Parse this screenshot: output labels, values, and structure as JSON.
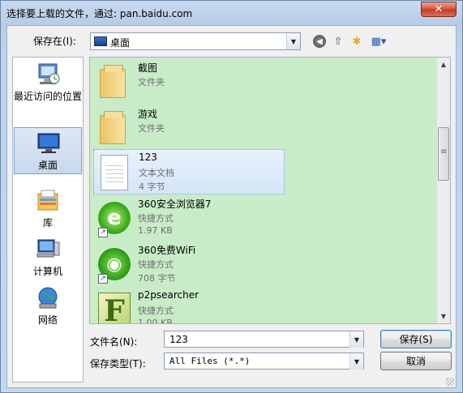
{
  "window": {
    "title": "选择要上载的文件，通过: pan.baidu.com",
    "close_glyph": "✕"
  },
  "toolbar": {
    "save_in_label": "保存在(I):",
    "save_in_value": "桌面",
    "icons": [
      "back-icon",
      "up-folder-icon",
      "new-folder-icon",
      "views-menu-icon"
    ]
  },
  "places": [
    {
      "label": "最近访问的位置",
      "icon": "recent-places-icon"
    },
    {
      "label": "桌面",
      "icon": "desktop-icon",
      "selected": true
    },
    {
      "label": "库",
      "icon": "libraries-icon"
    },
    {
      "label": "计算机",
      "icon": "computer-icon"
    },
    {
      "label": "网络",
      "icon": "network-icon"
    }
  ],
  "files": [
    {
      "name": "截图",
      "type": "文件夹",
      "size": "",
      "icon": "folder-icon"
    },
    {
      "name": "游戏",
      "type": "文件夹",
      "size": "",
      "icon": "folder-icon"
    },
    {
      "name": "123",
      "type": "文本文档",
      "size": "4 字节",
      "icon": "text-document-icon",
      "selected": true
    },
    {
      "name": "360安全浏览器7",
      "type": "快捷方式",
      "size": "1.97 KB",
      "icon": "360-browser-icon"
    },
    {
      "name": "360免费WiFi",
      "type": "快捷方式",
      "size": "708 字节",
      "icon": "360-wifi-icon"
    },
    {
      "name": "p2psearcher",
      "type": "快捷方式",
      "size": "1.00 KB",
      "icon": "p2psearcher-icon"
    }
  ],
  "form": {
    "filename_label": "文件名(N):",
    "filename_value": "123",
    "filetype_label": "保存类型(T):",
    "filetype_value": "All Files (*.*)",
    "save_button": "保存(S)",
    "cancel_button": "取消"
  },
  "colors": {
    "file_list_background": "#c9ecc8",
    "selection_border": "#6e9fd4"
  }
}
